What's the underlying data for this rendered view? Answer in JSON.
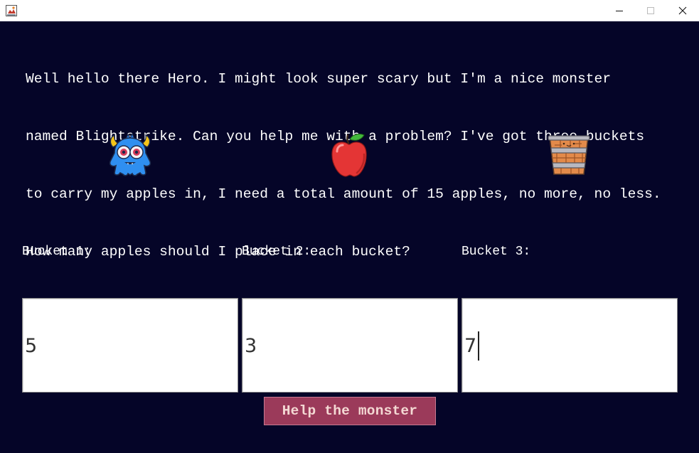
{
  "window": {
    "icon": "java-app-icon",
    "controls": [
      "minimize-icon",
      "maximize-icon",
      "close-icon"
    ]
  },
  "question_lines": [
    "Well hello there Hero. I might look super scary but I'm a nice monster",
    "named Blightstrike. Can you help me with a problem? I've got three buckets",
    "to carry my apples in, I need a total amount of 15 apples, no more, no less.",
    "How many apples should I place in each bucket?"
  ],
  "images": {
    "monster": "monster-icon",
    "apple": "apple-icon",
    "bucket": "bucket-icon"
  },
  "buckets": [
    {
      "label": "Bucket 1:",
      "value": "5"
    },
    {
      "label": "Bucket 2:",
      "value": "3"
    },
    {
      "label": "Bucket 3:",
      "value": "7"
    }
  ],
  "submit_label": "Help the monster",
  "colors": {
    "background": "#050528",
    "button": "#9b3a5a",
    "button_text": "#f4d9d4",
    "text": "#ffffff"
  }
}
